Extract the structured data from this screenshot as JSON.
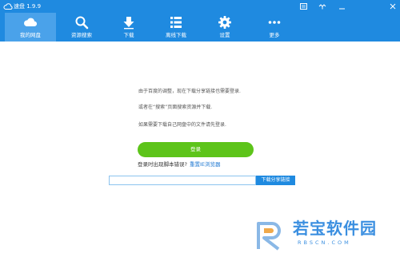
{
  "window": {
    "title": "速盘 1.9.9"
  },
  "window_controls": [
    "menu-icon",
    "restore-icon",
    "minimize-icon",
    "close-icon"
  ],
  "nav": {
    "items": [
      {
        "label": "我的网盘",
        "icon": "cloud-icon",
        "active": true
      },
      {
        "label": "资源搜索",
        "icon": "search-icon",
        "active": false
      },
      {
        "label": "下载",
        "icon": "download-icon",
        "active": false
      },
      {
        "label": "离线下载",
        "icon": "list-icon",
        "active": false
      },
      {
        "label": "设置",
        "icon": "gear-icon",
        "active": false
      },
      {
        "label": "更多",
        "icon": "more-icon",
        "active": false
      }
    ]
  },
  "main": {
    "info_lines": [
      "由于百度的调整，现在下载分享链接也需要登录.",
      "或者在“搜索”页面搜索资源并下载.",
      "如果需要下载自己网盘中的文件请先登录."
    ],
    "login_label": "登录",
    "script_error_text": "登录时出现脚本错误?",
    "reset_link": "重置IE浏览器",
    "share_input_value": "",
    "share_input_placeholder": "",
    "share_button_label": "下载分享链接"
  },
  "watermark": {
    "title": "若宝软件园",
    "subtitle": "RBSCN.COM"
  },
  "colors": {
    "header_blue": "#1f8ae0",
    "active_tab": "#4aa2ea",
    "login_green": "#5dc41a",
    "link_blue": "#1f78d1"
  }
}
